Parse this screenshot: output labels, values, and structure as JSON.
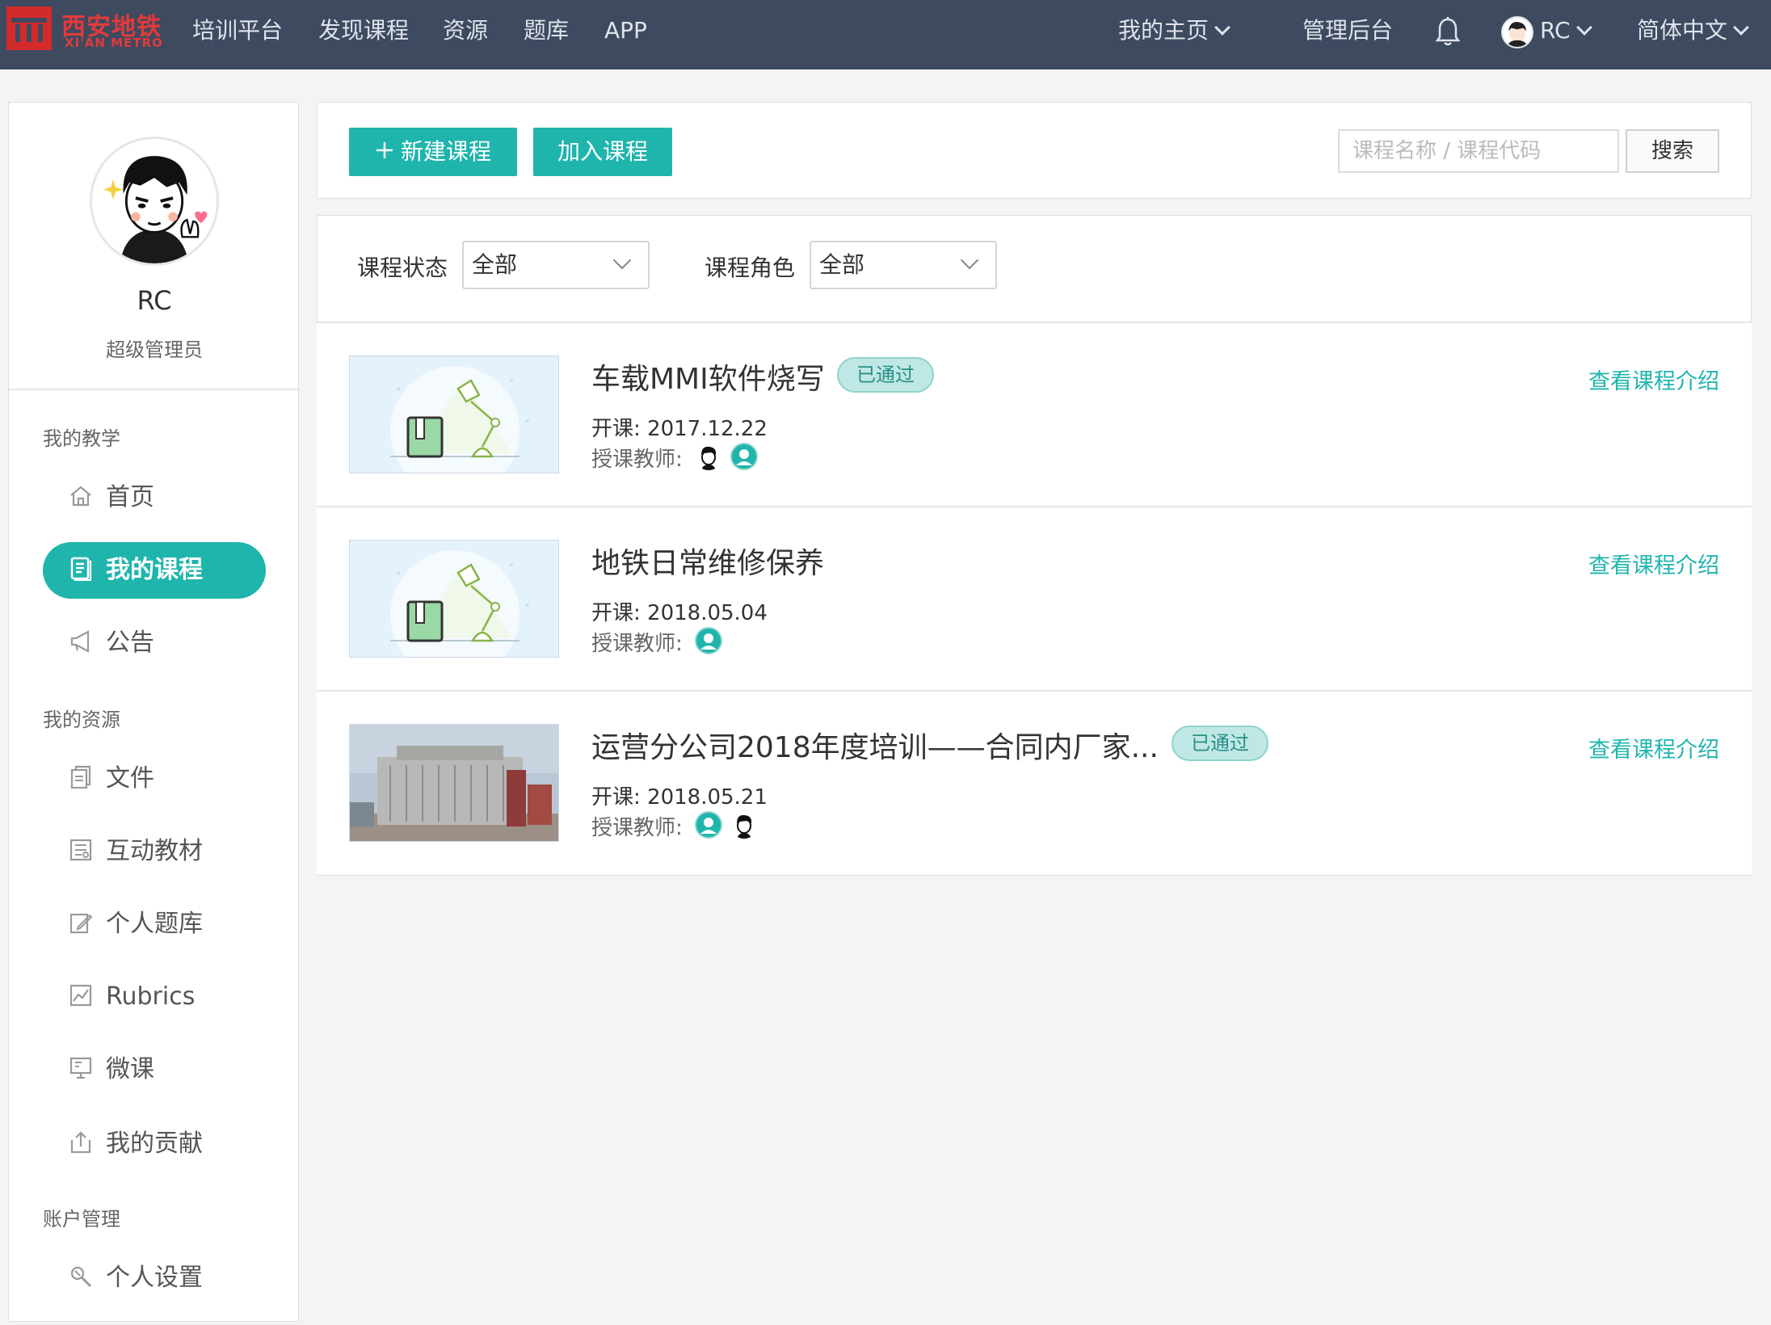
{
  "brand": {
    "name_cn": "西安地铁",
    "name_en": "XI'AN METRO"
  },
  "nav": {
    "items": [
      "培训平台",
      "发现课程",
      "资源",
      "题库",
      "APP"
    ],
    "my_home": "我的主页",
    "admin": "管理后台",
    "user": "RC",
    "language": "简体中文"
  },
  "profile": {
    "name": "RC",
    "role": "超级管理员"
  },
  "sidebar": {
    "section_teaching": "我的教学",
    "section_resources": "我的资源",
    "section_account": "账户管理",
    "items": {
      "home": "首页",
      "my_courses": "我的课程",
      "notice": "公告",
      "files": "文件",
      "interactive": "互动教材",
      "question_bank": "个人题库",
      "rubrics": "Rubrics",
      "micro": "微课",
      "contribution": "我的贡献",
      "settings": "个人设置"
    }
  },
  "toolbar": {
    "new_course": "新建课程",
    "join_course": "加入课程",
    "search_placeholder": "课程名称 / 课程代码",
    "search_button": "搜索"
  },
  "filters": {
    "status_label": "课程状态",
    "status_value": "全部",
    "role_label": "课程角色",
    "role_value": "全部"
  },
  "courses": [
    {
      "title": "车载MMI软件烧写",
      "badge": "已通过",
      "date": "开课: 2017.12.22",
      "teacher_label": "授课教师:",
      "view": "查看课程介绍"
    },
    {
      "title": "地铁日常维修保养",
      "badge": "",
      "date": "开课: 2018.05.04",
      "teacher_label": "授课教师:",
      "view": "查看课程介绍"
    },
    {
      "title": "运营分公司2018年度培训——合同内厂家...",
      "badge": "已通过",
      "date": "开课: 2018.05.21",
      "teacher_label": "授课教师:",
      "view": "查看课程介绍"
    }
  ],
  "colors": {
    "topbar": "#3d4a60",
    "accent": "#1fb5ad",
    "brand_red": "#d32b2b",
    "page_bg": "#f4f4f4"
  },
  "icons": [
    "bell-icon",
    "home-icon",
    "book-icon",
    "megaphone-icon",
    "file-icon",
    "interactive-icon",
    "edit-icon",
    "chart-icon",
    "monitor-icon",
    "share-icon",
    "wrench-icon",
    "plus-icon",
    "chevron-down-icon"
  ]
}
